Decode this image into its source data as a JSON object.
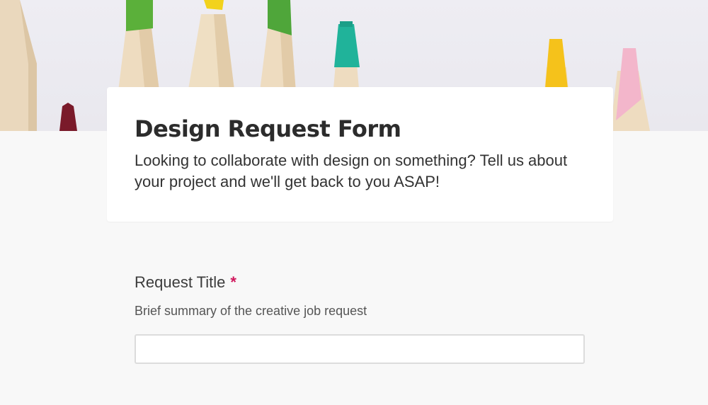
{
  "header": {
    "banner_image": "colored-pencils-banner",
    "title": "Design Request Form",
    "description": "Looking to collaborate with design on something? Tell us about your project and we'll get back to you ASAP!"
  },
  "questions": [
    {
      "label": "Request Title",
      "required_marker": "*",
      "help_text": "Brief summary of the creative job request",
      "value": "",
      "placeholder": ""
    }
  ],
  "colors": {
    "page_background": "#f8f8f8",
    "card_background": "#ffffff",
    "required_asterisk": "#d0175c",
    "title_text": "#2c2c2c"
  }
}
